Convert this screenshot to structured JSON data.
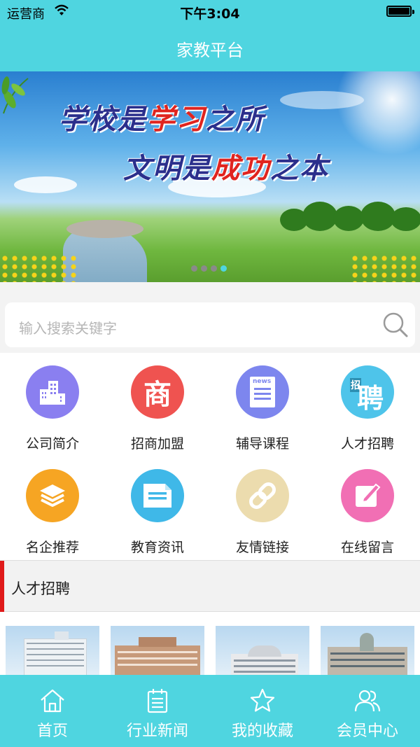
{
  "status_bar": {
    "carrier": "运营商",
    "time": "下午3:04"
  },
  "nav": {
    "title": "家教平台"
  },
  "banner": {
    "line1_a": "学校是",
    "line1_b": "学习",
    "line1_c": "之所",
    "line2_a": "文明是",
    "line2_b": "成功",
    "line2_c": "之本",
    "slides": 4,
    "active_slide": 4
  },
  "search": {
    "placeholder": "输入搜索关键字"
  },
  "grid": {
    "items": [
      {
        "label": "公司简介",
        "icon": "building-icon",
        "color": "#8a7ff0"
      },
      {
        "label": "招商加盟",
        "icon": "shop-icon",
        "color": "#ef5350",
        "glyph": "商"
      },
      {
        "label": "辅导课程",
        "icon": "news-icon",
        "color": "#7d86ee",
        "glyph": "news"
      },
      {
        "label": "人才招聘",
        "icon": "recruit-icon",
        "color": "#4ec4ea",
        "glyph": "聘",
        "glyph_small": "招"
      },
      {
        "label": "名企推荐",
        "icon": "layers-icon",
        "color": "#f6a523"
      },
      {
        "label": "教育资讯",
        "icon": "document-icon",
        "color": "#3fb8e8"
      },
      {
        "label": "友情链接",
        "icon": "link-icon",
        "color": "#ecdcae"
      },
      {
        "label": "在线留言",
        "icon": "edit-icon",
        "color": "#f16fb4"
      }
    ]
  },
  "section": {
    "title": "人才招聘"
  },
  "tabs": [
    {
      "label": "首页",
      "icon": "home-icon"
    },
    {
      "label": "行业新闻",
      "icon": "news-clipboard-icon"
    },
    {
      "label": "我的收藏",
      "icon": "star-icon"
    },
    {
      "label": "会员中心",
      "icon": "users-icon"
    }
  ],
  "colors": {
    "primary": "#4fd5e0",
    "accent_red": "#e01a1a"
  }
}
